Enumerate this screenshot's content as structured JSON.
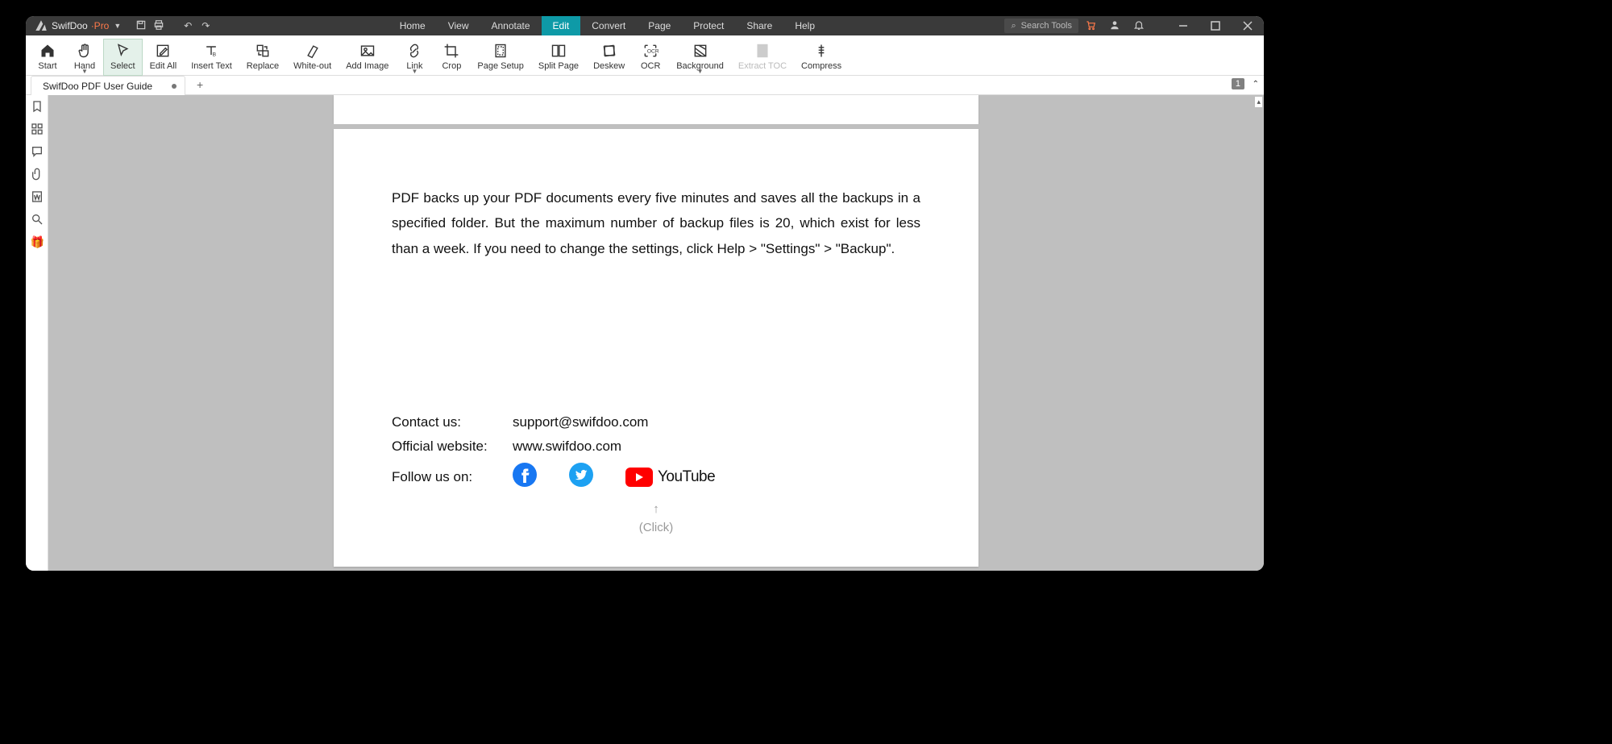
{
  "app": {
    "name": "SwifDoo",
    "variant": "·Pro"
  },
  "menus": [
    "Home",
    "View",
    "Annotate",
    "Edit",
    "Convert",
    "Page",
    "Protect",
    "Share",
    "Help"
  ],
  "activeMenuIndex": 3,
  "searchPlaceholder": "Search Tools",
  "ribbon": [
    {
      "id": "start",
      "label": "Start"
    },
    {
      "id": "hand",
      "label": "Hand",
      "dd": true
    },
    {
      "id": "select",
      "label": "Select",
      "active": true
    },
    {
      "id": "editall",
      "label": "Edit All"
    },
    {
      "id": "inserttext",
      "label": "Insert Text"
    },
    {
      "id": "replace",
      "label": "Replace"
    },
    {
      "id": "whiteout",
      "label": "White-out"
    },
    {
      "id": "addimage",
      "label": "Add Image"
    },
    {
      "id": "link",
      "label": "Link",
      "dd": true
    },
    {
      "id": "crop",
      "label": "Crop"
    },
    {
      "id": "pagesetup",
      "label": "Page Setup"
    },
    {
      "id": "splitpage",
      "label": "Split Page"
    },
    {
      "id": "deskew",
      "label": "Deskew"
    },
    {
      "id": "ocr",
      "label": "OCR"
    },
    {
      "id": "background",
      "label": "Background",
      "dd": true
    },
    {
      "id": "extracttoc",
      "label": "Extract TOC",
      "disabled": true
    },
    {
      "id": "compress",
      "label": "Compress"
    }
  ],
  "tab": {
    "title": "SwifDoo PDF User Guide"
  },
  "pageNumberBadge": "1",
  "doc": {
    "body": "PDF backs up your PDF documents every five minutes and saves all the backups in a specified folder. But the maximum number of backup files is 20, which exist for less than a week. If you need to change the settings, click Help > \"Settings\" > \"Backup\".",
    "contactLabel": "Contact us:",
    "contactValue": "support@swifdoo.com",
    "websiteLabel": "Official website:",
    "websiteValue": "www.swifdoo.com",
    "followLabel": "Follow us on:",
    "youtubeText": "YouTube",
    "clickHint": "(Click)"
  }
}
